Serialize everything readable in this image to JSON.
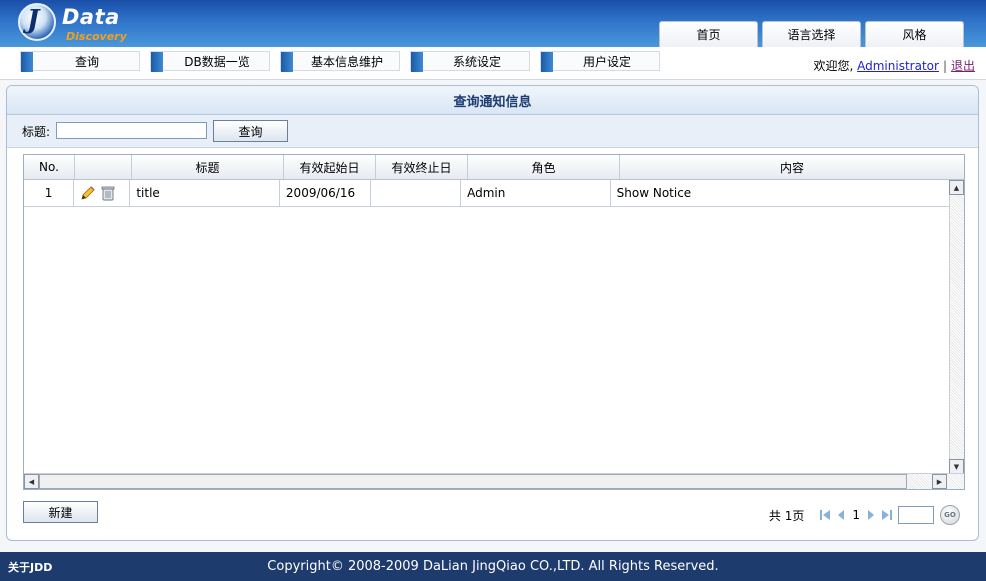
{
  "logo": {
    "letter": "J",
    "word": "Data",
    "sub": "Discovery"
  },
  "top_tabs": [
    "首页",
    "语言选择",
    "风格"
  ],
  "nav": [
    "查询",
    "DB数据一览",
    "基本信息维护",
    "系统设定",
    "用户设定"
  ],
  "welcome": {
    "prefix": "欢迎您,",
    "user": "Administrator",
    "sep": "|",
    "logout": "退出"
  },
  "panel": {
    "title": "查询通知信息"
  },
  "search": {
    "label": "标题:",
    "value": "",
    "placeholder": "",
    "button": "查询"
  },
  "table": {
    "headers": [
      "No.",
      "",
      "标题",
      "有效起始日",
      "有效终止日",
      "角色",
      "内容"
    ],
    "rows": [
      {
        "no": "1",
        "title": "title",
        "start": "2009/06/16",
        "end": "",
        "role": "Admin",
        "content": "Show Notice"
      }
    ]
  },
  "new_button": "新建",
  "pager": {
    "total": "共 1页",
    "current": "1",
    "input": "",
    "go": "GO"
  },
  "footer": {
    "about": "关于JDD",
    "copyright": "Copyright© 2008-2009 DaLian JingQiao CO.,LTD. All Rights Reserved."
  },
  "colors": {
    "header": "#2f74c9",
    "footer": "#1e3b6e",
    "accent": "#1a5aa6",
    "link": "#1f1fd0"
  }
}
